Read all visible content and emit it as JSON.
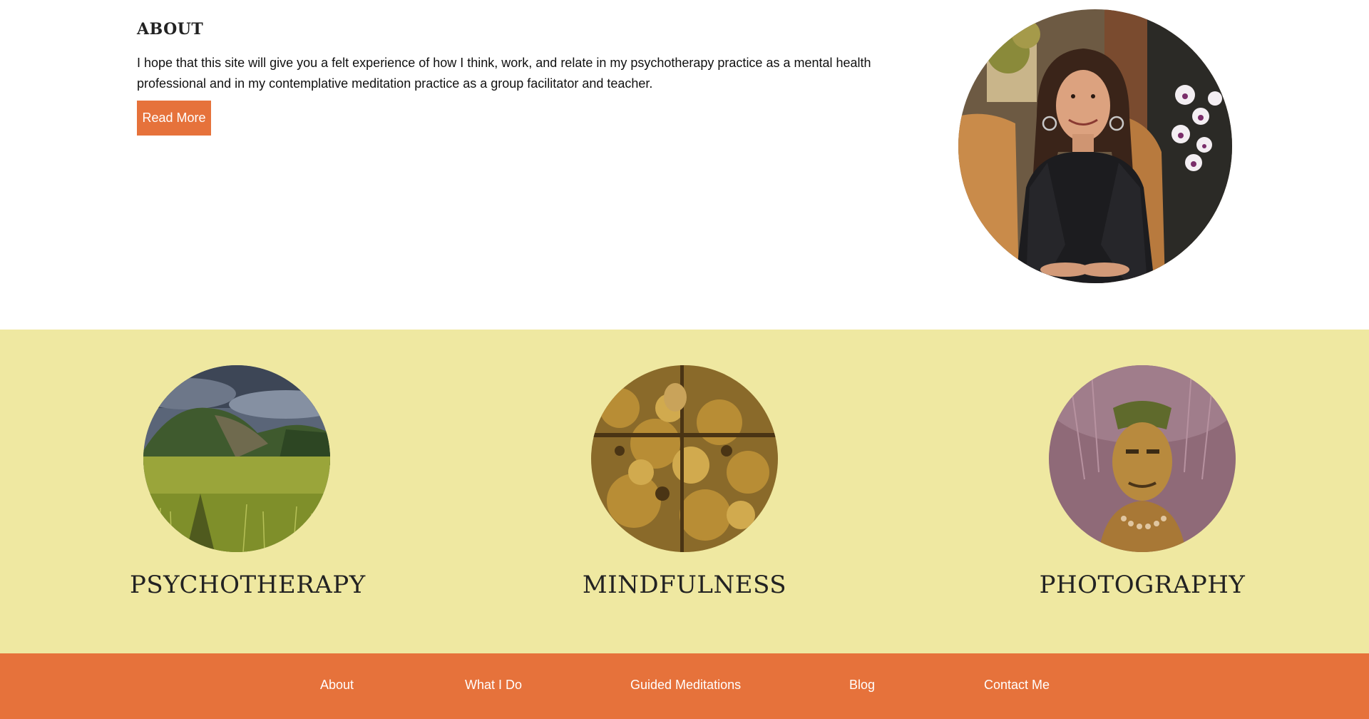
{
  "about": {
    "title": "ABOUT",
    "text": "I hope that this site will give you a felt experience of how I think, work, and relate in my psychotherapy practice as a mental health professional and in my contemplative meditation practice as a group facilitator and teacher.",
    "button_label": "Read More"
  },
  "services": [
    {
      "label": "PSYCHOTHERAPY"
    },
    {
      "label": "MINDFULNESS"
    },
    {
      "label": "PHOTOGRAPHY"
    }
  ],
  "nav": {
    "items": [
      {
        "label": "About"
      },
      {
        "label": "What I Do"
      },
      {
        "label": "Guided Meditations"
      },
      {
        "label": "Blog"
      },
      {
        "label": "Contact Me"
      }
    ]
  },
  "colors": {
    "accent": "#e6723b",
    "services_bg": "#efe8a1"
  }
}
